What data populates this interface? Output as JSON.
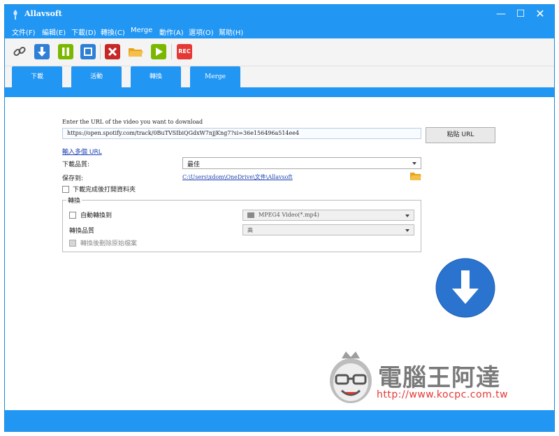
{
  "window": {
    "title": "Allavsoft",
    "controls": {
      "minimize": "—",
      "maximize": "☐",
      "close": "✕"
    }
  },
  "menu": {
    "items": [
      "文件(F)",
      "編輯(E)",
      "下載(D)",
      "轉換(C)",
      "Merge",
      "動作(A)",
      "選項(O)",
      "幫助(H)"
    ]
  },
  "toolbar": {
    "rec_label": "REC",
    "icons": [
      "link-icon",
      "download-icon",
      "pause-icon",
      "stop-icon",
      "delete-icon",
      "folder-icon",
      "play-icon",
      "rec-icon"
    ],
    "colors": {
      "blue": "#2e7fd6",
      "green": "#7ab800",
      "red": "#c62828",
      "folder": "#f0b323",
      "rec": "#e53935"
    }
  },
  "tabs": [
    {
      "label": "下載",
      "active": true
    },
    {
      "label": "活動",
      "active": false
    },
    {
      "label": "轉換",
      "active": false
    },
    {
      "label": "Merge",
      "active": false
    }
  ],
  "download": {
    "url_label": "Enter the URL of the video you want to download",
    "url_value": "https://open.spotify.com/track/0BuTVSIbiQGdxW7njjKng7?si=36e156496a514ee4",
    "paste_button": "粘貼 URL",
    "multi_url_link": "輸入多個 URL",
    "quality_label": "下載品質:",
    "quality_value": "最佳",
    "save_to_label": "保存到:",
    "save_to_path": "C:\\Users\\xdom\\OneDrive\\文件\\Allavsoft",
    "open_folder_label": "下載完成後打開資料夾",
    "open_folder_checked": false
  },
  "convert": {
    "group_label": "轉換",
    "auto_convert_label": "自動轉換到",
    "auto_convert_checked": false,
    "format_value": "MPEG4 Video(*.mp4)",
    "convert_quality_label": "轉換品質",
    "convert_quality_value": "高",
    "delete_original_label": "轉換後刪除原始檔案",
    "delete_original_checked": false
  },
  "watermark": {
    "title": "電腦王阿達",
    "url": "http://www.kocpc.com.tw"
  },
  "colors": {
    "accent": "#2196f3",
    "link": "#1a3fb0",
    "download_circle": "#2a73cf"
  }
}
